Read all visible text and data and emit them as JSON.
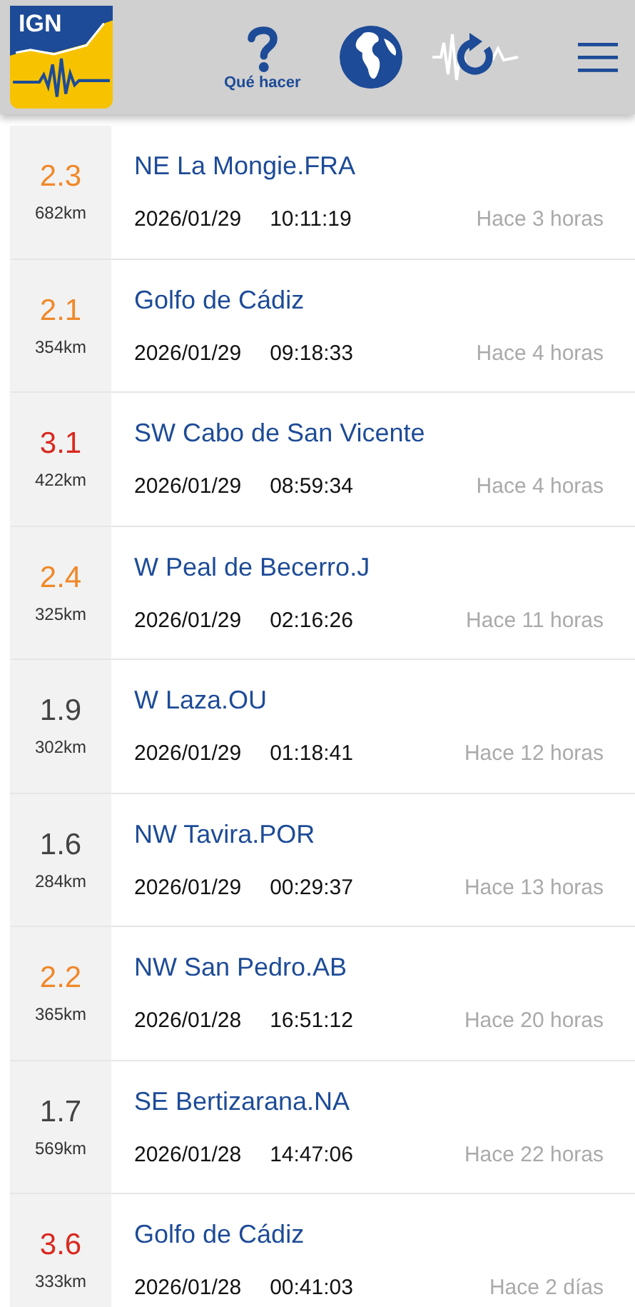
{
  "header": {
    "logo_text": "IGN",
    "help_label": "Qué hacer"
  },
  "events": [
    {
      "magnitude": "2.3",
      "color": "#f0882a",
      "distance": "682km",
      "location": "NE La Mongie.FRA",
      "date": "2026/01/29",
      "time": "10:11:19",
      "ago": "Hace 3 horas"
    },
    {
      "magnitude": "2.1",
      "color": "#f0882a",
      "distance": "354km",
      "location": "Golfo de Cádiz",
      "date": "2026/01/29",
      "time": "09:18:33",
      "ago": "Hace 4 horas"
    },
    {
      "magnitude": "3.1",
      "color": "#d9291f",
      "distance": "422km",
      "location": "SW Cabo de San Vicente",
      "date": "2026/01/29",
      "time": "08:59:34",
      "ago": "Hace 4 horas"
    },
    {
      "magnitude": "2.4",
      "color": "#f0882a",
      "distance": "325km",
      "location": "W Peal de Becerro.J",
      "date": "2026/01/29",
      "time": "02:16:26",
      "ago": "Hace 11 horas"
    },
    {
      "magnitude": "1.9",
      "color": "#444444",
      "distance": "302km",
      "location": "W Laza.OU",
      "date": "2026/01/29",
      "time": "01:18:41",
      "ago": "Hace 12 horas"
    },
    {
      "magnitude": "1.6",
      "color": "#444444",
      "distance": "284km",
      "location": "NW Tavira.POR",
      "date": "2026/01/29",
      "time": "00:29:37",
      "ago": "Hace 13 horas"
    },
    {
      "magnitude": "2.2",
      "color": "#f0882a",
      "distance": "365km",
      "location": "NW San Pedro.AB",
      "date": "2026/01/28",
      "time": "16:51:12",
      "ago": "Hace 20 horas"
    },
    {
      "magnitude": "1.7",
      "color": "#444444",
      "distance": "569km",
      "location": "SE Bertizarana.NA",
      "date": "2026/01/28",
      "time": "14:47:06",
      "ago": "Hace 22 horas"
    },
    {
      "magnitude": "3.6",
      "color": "#d9291f",
      "distance": "333km",
      "location": "Golfo de Cádiz",
      "date": "2026/01/28",
      "time": "00:41:03",
      "ago": "Hace 2 días"
    }
  ]
}
